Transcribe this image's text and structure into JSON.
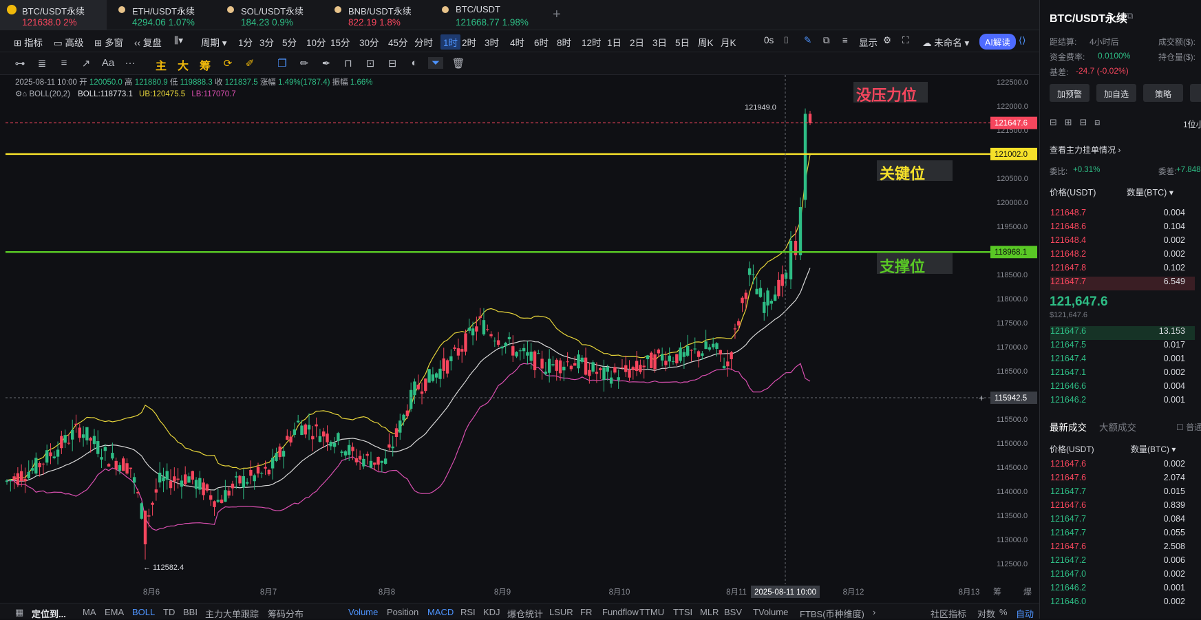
{
  "tabs": [
    {
      "name": "BTC/USDT永续",
      "price": "121638.0",
      "change": "2%",
      "dir": "down"
    },
    {
      "name": "ETH/USDT永续",
      "price": "4294.06",
      "change": "1.07%",
      "dir": "up"
    },
    {
      "name": "SOL/USDT永续",
      "price": "184.23",
      "change": "0.9%",
      "dir": "up"
    },
    {
      "name": "BNB/USDT永续",
      "price": "822.19",
      "change": "1.8%",
      "dir": "down"
    },
    {
      "name": "BTC/USDT",
      "price": "121668.77",
      "change": "1.98%",
      "dir": "up"
    }
  ],
  "new_tab": "+",
  "toolbar": {
    "indicators": "指标",
    "advanced": "高级",
    "multi_window": "多窗",
    "replay": "复盘",
    "period": "周期",
    "intervals": [
      "1分",
      "3分",
      "5分",
      "10分",
      "15分",
      "30分",
      "45分",
      "分时",
      "1时",
      "2时",
      "3时",
      "4时",
      "6时",
      "8时",
      "12时",
      "1日",
      "2日",
      "3日",
      "5日",
      "周K",
      "月K"
    ],
    "selected_interval": "1时",
    "seconds": "0s",
    "display": "显示",
    "unnamed": "未命名",
    "ai": "AI解读"
  },
  "drawing": {
    "font_tool": "Aa",
    "more": "···",
    "main": "主",
    "big": "大",
    "chips": "筹"
  },
  "ohlc": {
    "date": "2025-08-11 10:00",
    "open_label": "开",
    "open": "120050.0",
    "high_label": "高",
    "high": "121880.9",
    "low_label": "低",
    "low": "119888.3",
    "close_label": "收",
    "close": "121837.5",
    "chg_label": "涨幅",
    "chg": "1.49%(1787.4)",
    "amp_label": "振幅",
    "amp": "1.66%"
  },
  "boll": {
    "label": "BOLL(20,2)",
    "mid": "BOLL:118773.1",
    "ub": "UB:120475.5",
    "lb": "LB:117070.7"
  },
  "levels": {
    "resistance": "没压力位",
    "key": "关键位",
    "support": "支撑位"
  },
  "price_tags": {
    "current": "121647.6",
    "key": "121002.0",
    "support": "118968.1",
    "cursor": "115942.5",
    "high_mark": "121949.0",
    "low_mark": "← 112582.4"
  },
  "y_ticks": [
    "122500.0",
    "122000.0",
    "121500.0",
    "121000.0",
    "120500.0",
    "120000.0",
    "119500.0",
    "119000.0",
    "118500.0",
    "118000.0",
    "117500.0",
    "117000.0",
    "116500.0",
    "116000.0",
    "115500.0",
    "115000.0",
    "114500.0",
    "114000.0",
    "113500.0",
    "113000.0",
    "112500.0"
  ],
  "x_ticks": [
    "8月6",
    "8月7",
    "8月8",
    "8月9",
    "8月10",
    "8月11",
    "8月12",
    "8月13"
  ],
  "x_cursor": "2025-08-11 10:00",
  "x_right": [
    "筹",
    "爆"
  ],
  "bottom": {
    "locate": "定位到...",
    "inds": [
      "MA",
      "EMA",
      "BOLL",
      "TD",
      "BBI",
      "主力大单跟踪",
      "筹码分布"
    ],
    "subs": [
      "Volume",
      "Position",
      "MACD",
      "RSI",
      "KDJ",
      "爆仓统计",
      "LSUR",
      "FR",
      "Fundflow",
      "TTMU",
      "TTSI",
      "MLR",
      "BSV",
      "TVolume",
      "FTBS(币种维度)"
    ],
    "community": "社区指标",
    "log": "对数",
    "pct": "%",
    "auto": "自动",
    "arrow": "›"
  },
  "rp": {
    "title": "BTC/USDT永续",
    "settle_label": "距结算:",
    "settle": "4小时后",
    "vol_label": "成交额($):",
    "fund_label": "资金费率:",
    "fund": "0.0100%",
    "oi_label": "持仓量($):",
    "basis_label": "基差:",
    "basis": "-24.7 (-0.02%)",
    "btns": [
      "加预警",
      "加自选",
      "策略"
    ],
    "precision": "1位小",
    "main_orders": "查看主力挂单情况",
    "ratio_label": "委比:",
    "ratio": "+0.31%",
    "diff_label": "委差:",
    "diff": "+7.848",
    "col_price": "价格(USDT)",
    "col_qty": "数量(BTC)",
    "asks": [
      [
        "121648.7",
        "0.004"
      ],
      [
        "121648.6",
        "0.104"
      ],
      [
        "121648.4",
        "0.002"
      ],
      [
        "121648.2",
        "0.002"
      ],
      [
        "121647.8",
        "0.102"
      ],
      [
        "121647.7",
        "6.549"
      ]
    ],
    "last": "121,647.6",
    "last_usd": "$121,647.6",
    "bids": [
      [
        "121647.6",
        "13.153"
      ],
      [
        "121647.5",
        "0.017"
      ],
      [
        "121647.4",
        "0.001"
      ],
      [
        "121647.1",
        "0.002"
      ],
      [
        "121646.6",
        "0.004"
      ],
      [
        "121646.2",
        "0.001"
      ]
    ],
    "trades_tab": "最新成交",
    "big_trades_tab": "大额成交",
    "normal": "普通",
    "trades": [
      [
        "121647.6",
        "0.002",
        "down"
      ],
      [
        "121647.6",
        "2.074",
        "down"
      ],
      [
        "121647.7",
        "0.015",
        "up"
      ],
      [
        "121647.6",
        "0.839",
        "down"
      ],
      [
        "121647.7",
        "0.084",
        "up"
      ],
      [
        "121647.7",
        "0.055",
        "up"
      ],
      [
        "121647.6",
        "2.508",
        "down"
      ],
      [
        "121647.2",
        "0.006",
        "up"
      ],
      [
        "121647.0",
        "0.002",
        "up"
      ],
      [
        "121646.2",
        "0.001",
        "up"
      ],
      [
        "121646.0",
        "0.002",
        "up"
      ]
    ]
  },
  "colors": {
    "up": "#2ebd85",
    "down": "#f6465d",
    "key": "#f5e02a",
    "support": "#59c825",
    "resistance": "#f6465d",
    "mid": "#d8d8d8",
    "ub": "#e6d43a",
    "lb": "#d94fb0"
  }
}
